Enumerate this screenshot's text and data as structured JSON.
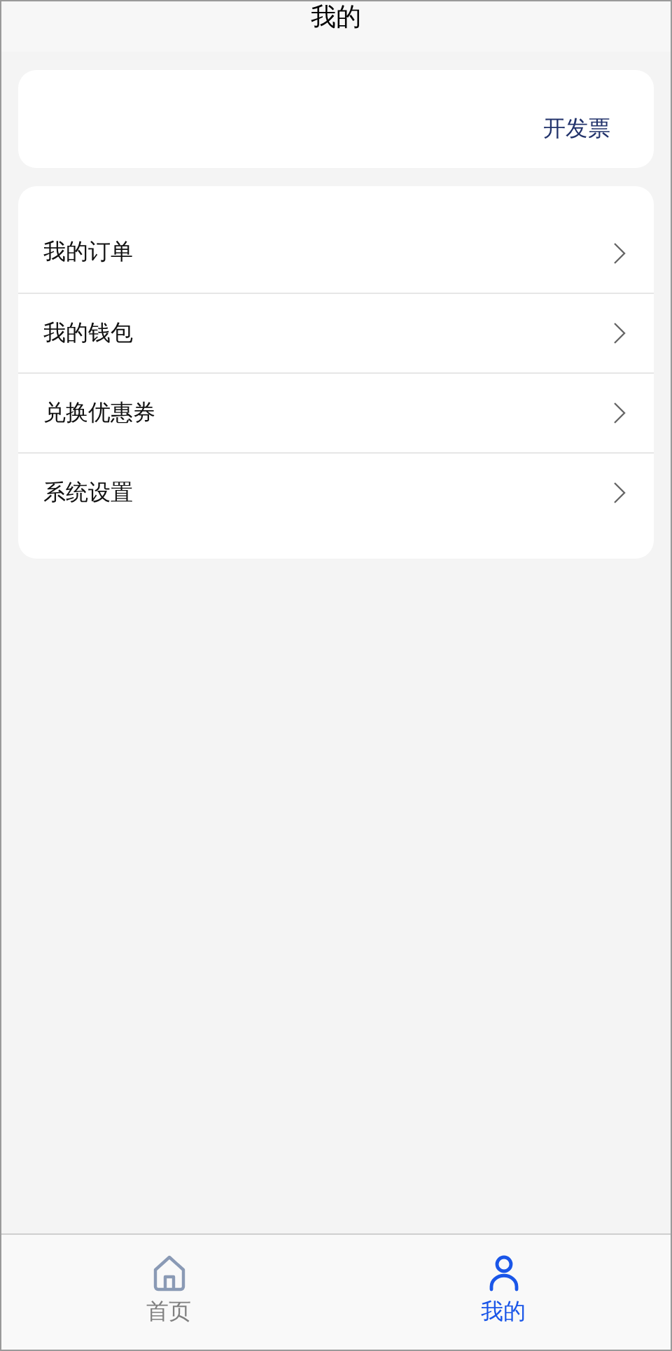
{
  "header": {
    "title": "我的"
  },
  "invoice_card": {
    "action": "开发票"
  },
  "menu": [
    {
      "label": "我的订单"
    },
    {
      "label": "我的钱包"
    },
    {
      "label": "兑换优惠券"
    },
    {
      "label": "系统设置"
    }
  ],
  "tab_bar": [
    {
      "kind": "home",
      "label": "首页",
      "selected": false
    },
    {
      "kind": "profile",
      "label": "我的",
      "selected": true
    }
  ]
}
